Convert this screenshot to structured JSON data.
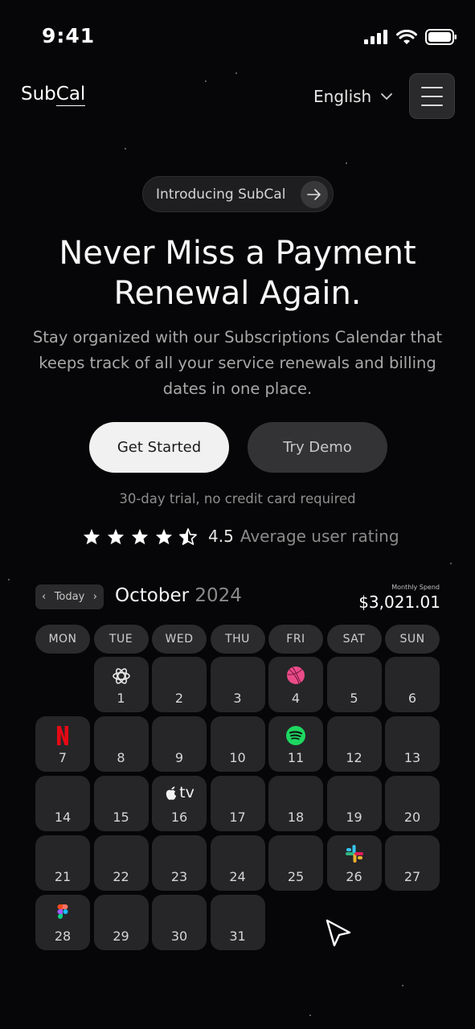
{
  "status_bar": {
    "time": "9:41"
  },
  "nav": {
    "logo_part1": "Sub",
    "logo_part2": "Cal",
    "language": "English"
  },
  "hero": {
    "intro_pill": "Introducing SubCal",
    "title_line1": "Never Miss a Payment",
    "title_line2": "Renewal Again.",
    "subtitle": "Stay organized with our Subscriptions Calendar that keeps track of all your service renewals and billing dates in one place.",
    "primary_button": "Get Started",
    "secondary_button": "Try Demo",
    "trial_note": "30-day trial, no credit card required",
    "rating_value": "4.5",
    "rating_label": "Average user rating",
    "rating_stars": 4.5
  },
  "calendar": {
    "today_label": "Today",
    "month": "October",
    "year": "2024",
    "spend_label": "Monthly Spend",
    "spend_value": "$3,021.01",
    "weekdays": [
      "MON",
      "TUE",
      "WED",
      "THU",
      "FRI",
      "SAT",
      "SUN"
    ],
    "days": [
      {
        "num": ""
      },
      {
        "num": "1",
        "icon": "openai-icon"
      },
      {
        "num": "2"
      },
      {
        "num": "3"
      },
      {
        "num": "4",
        "icon": "dribbble-icon"
      },
      {
        "num": "5"
      },
      {
        "num": "6"
      },
      {
        "num": "7",
        "icon": "netflix-icon"
      },
      {
        "num": "8"
      },
      {
        "num": "9"
      },
      {
        "num": "10"
      },
      {
        "num": "11",
        "icon": "spotify-icon"
      },
      {
        "num": "12"
      },
      {
        "num": "13"
      },
      {
        "num": "14"
      },
      {
        "num": "15"
      },
      {
        "num": "16",
        "icon": "apple-tv-icon",
        "icon_text": "tv"
      },
      {
        "num": "17"
      },
      {
        "num": "18"
      },
      {
        "num": "19"
      },
      {
        "num": "20"
      },
      {
        "num": "21"
      },
      {
        "num": "22"
      },
      {
        "num": "23"
      },
      {
        "num": "24"
      },
      {
        "num": "25"
      },
      {
        "num": "26",
        "icon": "slack-icon"
      },
      {
        "num": "27"
      },
      {
        "num": "28",
        "icon": "figma-icon"
      },
      {
        "num": "29"
      },
      {
        "num": "30"
      },
      {
        "num": "31"
      }
    ]
  },
  "colors": {
    "background": "#060608",
    "spotify": "#1ed760",
    "netflix": "#e50914",
    "dribbble": "#ea4c89"
  }
}
